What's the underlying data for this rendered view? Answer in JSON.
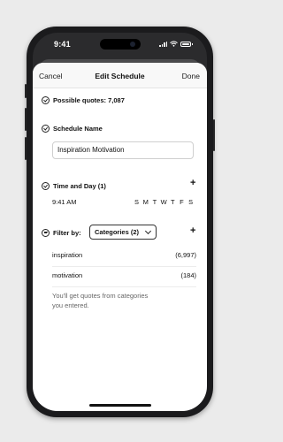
{
  "status_bar": {
    "time": "9:41"
  },
  "nav": {
    "cancel": "Cancel",
    "title": "Edit Schedule",
    "done": "Done"
  },
  "possible_quotes": "Possible quotes: 7,087",
  "schedule_name": {
    "label": "Schedule Name",
    "value": "Inspiration Motivation"
  },
  "time_and_day": {
    "label": "Time and Day (1)",
    "time": "9:41 AM",
    "days": [
      "S",
      "M",
      "T",
      "W",
      "T",
      "F",
      "S"
    ]
  },
  "filter": {
    "label": "Filter by:",
    "selected": "Categories (2)",
    "categories": [
      {
        "name": "inspiration",
        "count": "(6,997)"
      },
      {
        "name": "motivation",
        "count": "(184)"
      }
    ],
    "note": "You'll get quotes from categories you entered."
  },
  "icons": [
    "checkmark-circle-icon",
    "filter-circle-icon",
    "plus-icon",
    "chevron-down-icon"
  ]
}
